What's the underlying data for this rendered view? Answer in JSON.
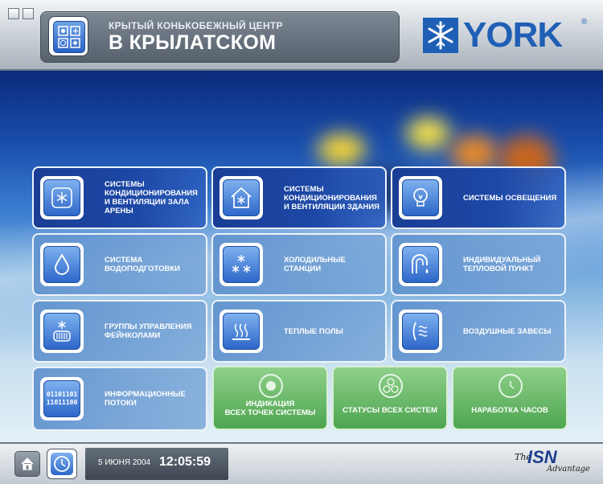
{
  "header": {
    "title_line1": "КРЫТЫЙ КОНЬКОБЕЖНЫЙ ЦЕНТР",
    "title_line2": "В КРЫЛАТСКОМ",
    "brand_logo_text": "YORK",
    "brand_registered": "®",
    "brand_color": "#1f5fb5"
  },
  "tiles": [
    {
      "label": "СИСТЕМЫ КОНДИЦИОНИРОВАНИЯ И ВЕНТИЛЯЦИИ ЗАЛА АРЕНЫ",
      "icon": "snowflake-panel-icon"
    },
    {
      "label": "СИСТЕМЫ КОНДИЦИОНИРОВАНИЯ И ВЕНТИЛЯЦИИ ЗДАНИЯ",
      "icon": "house-snowflake-icon"
    },
    {
      "label": "СИСТЕМЫ ОСВЕЩЕНИЯ",
      "icon": "lightbulb-icon"
    },
    {
      "label": "СИСТЕМА ВОДОПОДГОТОВКИ",
      "icon": "water-drop-icon"
    },
    {
      "label": "ХОЛОДИЛЬНЫЕ СТАНЦИИ",
      "icon": "snowflakes-icon"
    },
    {
      "label": "ИНДИВИДУАЛЬНЫЙ ТЕПЛОВОЙ ПУНКТ",
      "icon": "faucet-icon"
    },
    {
      "label": "ГРУППЫ УПРАВЛЕНИЯ ФЕЙНКОЛАМИ",
      "icon": "fan-coil-icon"
    },
    {
      "label": "ТЕПЛЫЕ ПОЛЫ",
      "icon": "heated-floor-icon"
    },
    {
      "label": "ВОЗДУШНЫЕ ЗАВЕСЫ",
      "icon": "air-curtain-icon"
    },
    {
      "label": "ИНФОРМАЦИОННЫЕ ПОТОКИ",
      "icon": "binary-data-icon",
      "icon_text_1": "01101101",
      "icon_text_2": "11011100"
    }
  ],
  "status_tiles": [
    {
      "label_1": "ИНДИКАЦИЯ",
      "label_2": "ВСЕХ ТОЧЕК СИСТЕМЫ",
      "icon": "target-icon"
    },
    {
      "label": "СТАТУСЫ ВСЕХ СИСТЕМ",
      "icon": "three-circles-icon"
    },
    {
      "label": "НАРАБОТКА ЧАСОВ",
      "icon": "clock-icon"
    }
  ],
  "footer": {
    "date": "5 ИЮНЯ 2004",
    "time": "12:05:59",
    "logo_the": "The",
    "logo_isn": "ISN",
    "logo_advantage": "Advantage"
  }
}
